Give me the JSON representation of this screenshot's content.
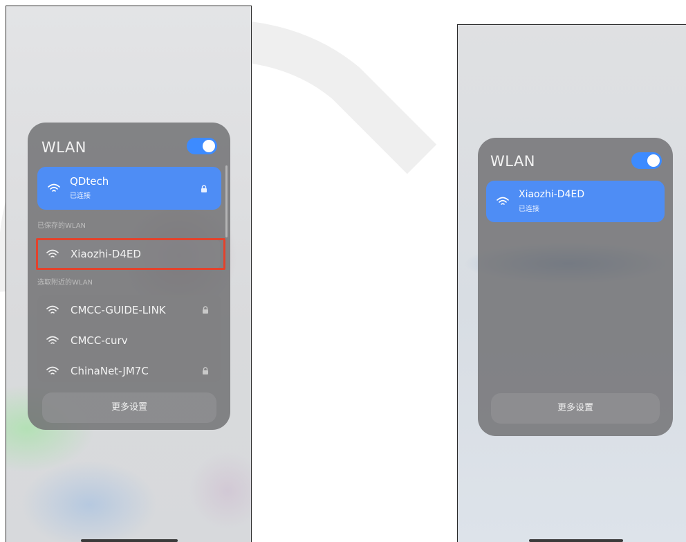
{
  "left_screen": {
    "panel": {
      "title": "WLAN",
      "toggle_on": true,
      "connected": {
        "name": "QDtech",
        "status": "已连接",
        "icon": "wifi-icon",
        "locked": true
      },
      "saved_section_label": "已保存的WLAN",
      "saved_networks": [
        {
          "name": "Xiaozhi-D4ED",
          "icon": "wifi-icon",
          "highlighted": true
        }
      ],
      "nearby_section_label": "选取附近的WLAN",
      "nearby_networks": [
        {
          "name": "CMCC-GUIDE-LINK",
          "icon": "wifi-icon",
          "locked": true
        },
        {
          "name": "CMCC-curv",
          "icon": "wifi-icon",
          "locked": false
        },
        {
          "name": "ChinaNet-JM7C",
          "icon": "wifi-icon",
          "locked": true
        }
      ],
      "more_settings_label": "更多设置"
    }
  },
  "right_screen": {
    "panel": {
      "title": "WLAN",
      "toggle_on": true,
      "connected": {
        "name": "Xiaozhi-D4ED",
        "status": "已连接",
        "icon": "wifi-icon"
      },
      "more_settings_label": "更多设置"
    }
  },
  "colors": {
    "accent_blue": "#4e8df5",
    "toggle_blue": "#3d8bff",
    "highlight_red": "#e3422c",
    "panel_gray": "#6e6e70"
  }
}
